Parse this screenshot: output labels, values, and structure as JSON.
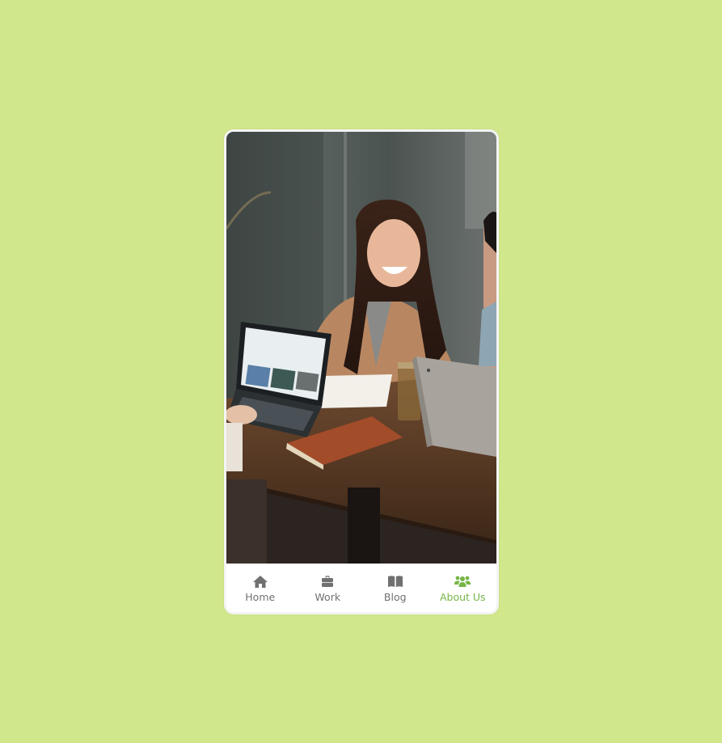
{
  "app": {
    "background_color": "#d1e78b",
    "accent_color": "#76b648",
    "inactive_color": "#707070"
  },
  "hero": {
    "image_semantic": "people-working-on-laptops-at-cafe-table"
  },
  "nav": {
    "active_index": 3,
    "items": [
      {
        "label": "Home",
        "icon": "home-icon"
      },
      {
        "label": "Work",
        "icon": "briefcase-icon"
      },
      {
        "label": "Blog",
        "icon": "book-open-icon"
      },
      {
        "label": "About Us",
        "icon": "users-icon"
      }
    ]
  }
}
